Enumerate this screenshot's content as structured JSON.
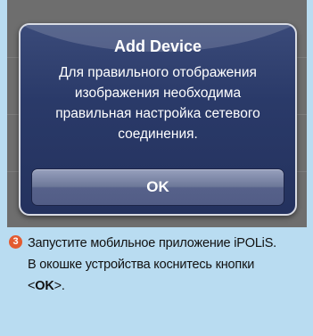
{
  "dialog": {
    "title": "Add Device",
    "message": "Для правильного отображения\nизображения необходима\nправильная настройка сетевого\nсоединения.",
    "ok_label": "OK"
  },
  "instruction": {
    "step_number": "3",
    "line1": "Запустите мобильное приложение iPOLiS.",
    "line2": "В окошке устройства коснитесь кнопки",
    "line3_prefix": "<",
    "line3_bold": "OK",
    "line3_suffix": ">."
  },
  "colors": {
    "page_background": "#b9dcf1",
    "step_badge": "#e35a2f",
    "dialog_background": "#2a3a69"
  }
}
